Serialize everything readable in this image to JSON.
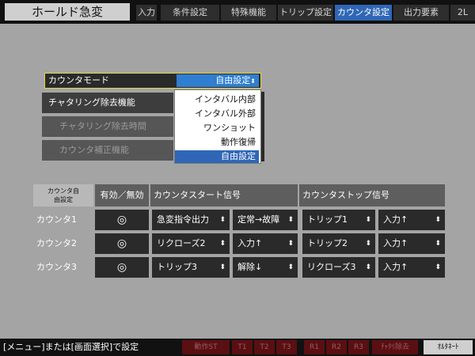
{
  "app_title": "ホールド急変",
  "tabs": [
    {
      "label": "入力"
    },
    {
      "label": "条件設定"
    },
    {
      "label": "特殊機能"
    },
    {
      "label": "トリップ設定"
    },
    {
      "label": "カウンタ設定"
    },
    {
      "label": "出力要素"
    },
    {
      "label": "2L"
    }
  ],
  "active_tab": "カウンタ設定",
  "mode": {
    "label": "カウンタモード",
    "value": "自由設定"
  },
  "side_rows": [
    {
      "label": "チャタリング除去機能"
    },
    {
      "label": "チャタリング除去時間"
    },
    {
      "label": "カウンタ補正機能"
    }
  ],
  "dropdown": {
    "options": [
      "インタバル内部",
      "インタバル外部",
      "ワンショット",
      "動作復帰",
      "自由設定"
    ],
    "selected": "自由設定"
  },
  "table": {
    "headers": {
      "counter": "カウンタ自由設定",
      "enable": "有効／無効",
      "start": "カウンタスタート信号",
      "stop": "カウンタストップ信号"
    },
    "rows": [
      {
        "name": "カウンタ1",
        "enabled": "◎",
        "start_signal": "急変指令出力",
        "start_edge": "定常→故障",
        "stop_signal": "トリップ1",
        "stop_edge": "入力↑"
      },
      {
        "name": "カウンタ2",
        "enabled": "◎",
        "start_signal": "リクローズ2",
        "start_edge": "入力↑",
        "stop_signal": "トリップ2",
        "stop_edge": "入力↑"
      },
      {
        "name": "カウンタ3",
        "enabled": "◎",
        "start_signal": "トリップ3",
        "start_edge": "解除↓",
        "stop_signal": "リクローズ3",
        "stop_edge": "入力↑"
      }
    ]
  },
  "status": "[メニュー]または[画面選択]で設定",
  "bottom_buttons": [
    "動作ST",
    "T1",
    "T2",
    "T3",
    "R1",
    "R2",
    "R3",
    "ﾁｬﾀﾘ除去",
    "ｵﾙﾀﾈｰﾄ"
  ],
  "icons": {
    "caret": "updown-caret-icon",
    "check": "double-circle-icon"
  }
}
